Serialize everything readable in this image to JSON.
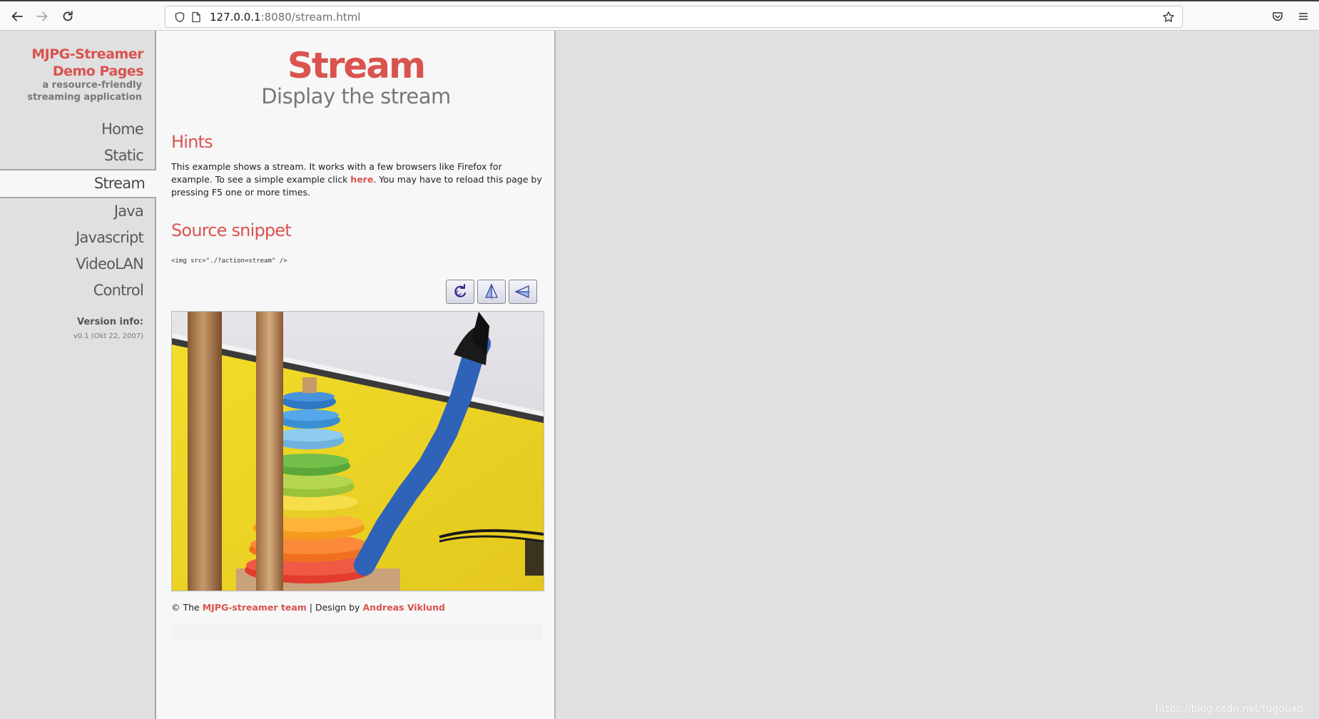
{
  "browser": {
    "url_host": "127.0.0.1",
    "url_path": ":8080/stream.html",
    "icons": [
      "back-arrow-icon",
      "forward-arrow-icon",
      "reload-icon",
      "shield-icon",
      "page-icon",
      "star-icon",
      "pocket-icon",
      "menu-icon"
    ]
  },
  "sidebar": {
    "brand_line1": "MJPG-Streamer",
    "brand_line2": "Demo Pages",
    "tagline_line1": "a resource-friendly",
    "tagline_line2": "streaming application",
    "nav": [
      {
        "label": "Home"
      },
      {
        "label": "Static"
      },
      {
        "label": "Stream",
        "active": true
      },
      {
        "label": "Java"
      },
      {
        "label": "Javascript"
      },
      {
        "label": "VideoLAN"
      },
      {
        "label": "Control"
      }
    ],
    "version_label": "Version info:",
    "version_value": "v0.1 (Okt 22, 2007)"
  },
  "main": {
    "title": "Stream",
    "subtitle": "Display the stream",
    "hints_heading": "Hints",
    "hints_part1": "This example shows a stream. It works with a few browsers like Firefox for example. To see a simple example click ",
    "hints_link": "here",
    "hints_part2": ". You may have to reload this page by pressing F5 one or more times.",
    "source_heading": "Source snippet",
    "source_code": "<img src=\"./?action=stream\" />",
    "controls": [
      "rotate-icon",
      "flip-vertical-icon",
      "flip-horizontal-icon"
    ]
  },
  "footer": {
    "prefix": "© The ",
    "team_link": "MJPG-streamer team",
    "middle": " | Design by ",
    "designer_link": "Andreas Viklund"
  },
  "watermark": "https://blog.csdn.net/tugouxp",
  "colors": {
    "accent": "#d9534f",
    "sidebar_bg": "#e0e0e0",
    "content_bg": "#f7f7f7"
  }
}
